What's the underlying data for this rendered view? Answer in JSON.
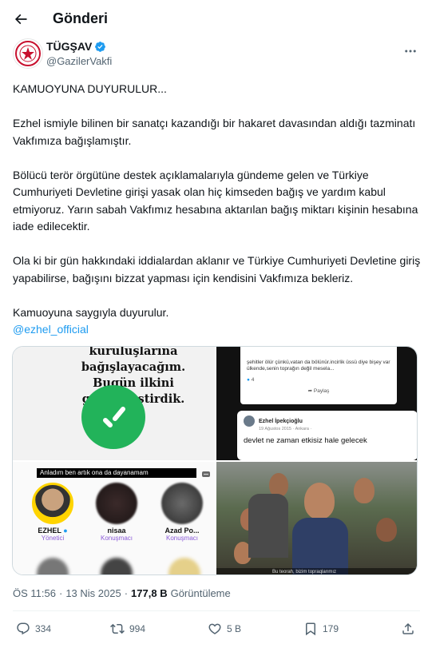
{
  "header": {
    "title": "Gönderi",
    "back_icon": "arrow-left-icon"
  },
  "author": {
    "name": "TÜGŞAV",
    "handle": "@GazilerVakfi",
    "verified_icon": "verified-badge-icon",
    "more_icon": "more-horizontal-icon"
  },
  "tweet": {
    "paragraphs": [
      "KAMUOYUNA DUYURULUR...",
      "Ezhel ismiyle bilinen bir sanatçı kazandığı bir hakaret davasından aldığı tazminatı Vakfımıza bağışlamıştır.",
      "Bölücü terör örgütüne destek açıklamalarıyla gündeme gelen ve Türkiye Cumhuriyeti Devletine girişi yasak olan hiç kimseden bağış ve yardım kabul etmiyoruz. Yarın sabah Vakfımız hesabına aktarılan bağış miktarı kişinin hesabına iade edilecektir.",
      "Ola ki bir gün hakkındaki iddialardan aklanır ve Türkiye Cumhuriyeti Devletine giriş yapabilirse, bağışını bizzat yapması için kendisini Vakfımıza bekleriz.",
      "Kamuoyuna saygıyla duyurulur."
    ],
    "mention": "@ezhel_official"
  },
  "media": {
    "tile1": {
      "heading_line1": "kuruluşlarına",
      "heading_line2": "bağışlayacağım.",
      "heading_line3": "Bugün ilkini",
      "heading_line4": "gerçekleştirdik."
    },
    "tile2": {
      "card1_text": "şehitler ölür çünkü,vatan da bölünür.incirlik üssü diye bişey var ülkende,senin toprağın değil mesela...",
      "card1_likes": "4",
      "card1_share": "Paylaş",
      "card2_name": "Ezhel İpekçioğlu",
      "card2_date": "19 Ağustos 2015 · Ankara ·",
      "card2_text": "devlet ne zaman etkisiz hale gelecek"
    },
    "tile3": {
      "live_caption": "Anladım ben artık ona da dayanamam",
      "user1_name": "EZHEL",
      "user1_role": "Yönetici",
      "user2_name": "nisaa",
      "user2_role": "Konuşmacı",
      "user3_name": "Azad Po...",
      "user3_role": "Konuşmacı"
    },
    "tile4": {
      "caption": "Bu teorah, bizim topraqlarımız"
    }
  },
  "meta": {
    "time": "ÖS 11:56",
    "separator": "·",
    "date": "13 Nis 2025",
    "views_count": "177,8 B",
    "views_label": "Görüntüleme"
  },
  "actions": {
    "replies": "334",
    "reposts": "994",
    "likes": "5 B",
    "bookmarks": "179"
  },
  "colors": {
    "accent": "#1d9bf0",
    "text": "#0f1419",
    "muted": "#536471"
  }
}
